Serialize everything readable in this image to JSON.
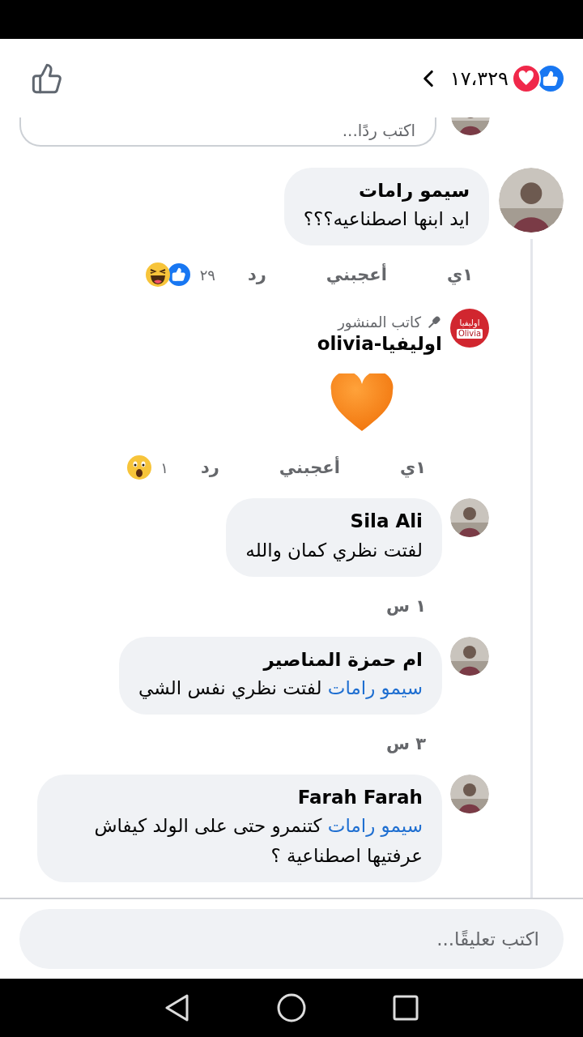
{
  "header": {
    "reactions": [
      {
        "kind": "like"
      },
      {
        "kind": "love"
      }
    ],
    "reaction_count": "١٧،٣٢٩"
  },
  "reply_field": {
    "placeholder": "اكتب ردًا..."
  },
  "thread": {
    "comment": {
      "author": "سيمو رامات",
      "kind": "text",
      "text": "ايد ابنها اصطناعيه؟؟؟",
      "time": "١ي",
      "like_label": "أعجبني",
      "reply_label": "رد",
      "reaction_count": "٢٩",
      "reactions": [
        {
          "kind": "like"
        },
        {
          "kind": "haha"
        }
      ]
    },
    "replies": [
      {
        "author": "اوليفيا-olivia",
        "badge": "كاتب المنشور",
        "avatar": {
          "kind": "logo",
          "lines": [
            "اوليفيا",
            "Olivia"
          ]
        },
        "kind": "sticker",
        "time": "١ي",
        "like_label": "أعجبني",
        "reply_label": "رد",
        "reaction_count": "١",
        "reactions": [
          {
            "kind": "wow"
          }
        ]
      },
      {
        "author": "Sila Ali",
        "kind": "text",
        "text": "لفتت نظري كمان والله",
        "time": "١ س"
      },
      {
        "author": "ام حمزة المناصير",
        "kind": "text",
        "mention": "سيمو رامات",
        "text": "لفتت نظري نفس الشي",
        "time": "٣ س"
      },
      {
        "author": "Farah Farah",
        "kind": "text",
        "mention": "سيمو رامات",
        "text": "كتنمرو حتى على الولد كيفاش عرفتيها اصطناعية ؟"
      }
    ]
  },
  "composer": {
    "placeholder": "اكتب تعليقًا..."
  }
}
